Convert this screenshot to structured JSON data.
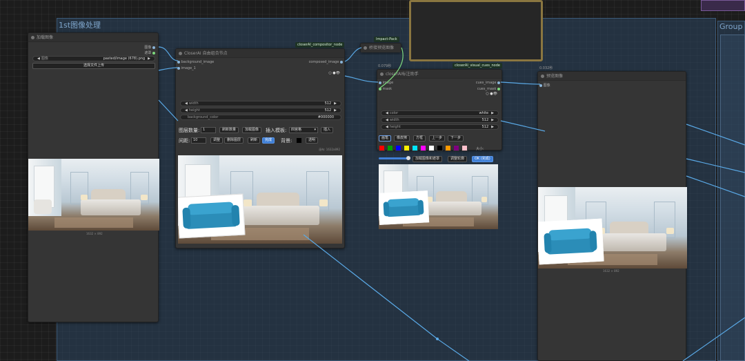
{
  "groups": [
    {
      "title": "1st图像处理"
    },
    {
      "title": "Group"
    }
  ],
  "colors": {
    "wire": "#5aa9e6",
    "canvas": "#1c1c1c",
    "node": "#353535",
    "accent": "#3f7fd6"
  },
  "load_image": {
    "title": "加载图像",
    "out_image": "图像",
    "out_mask": "遮罩",
    "image_widget_label": "图像",
    "image_widget_value": "pasted/image (678).png",
    "upload_button": "选择文件上传",
    "caption": "1632 × 892"
  },
  "compositor": {
    "badge": "closerAI_compositor_node",
    "title": "CloserAI 自由组合节点",
    "in_background": "background_image",
    "in_image1": "image_1",
    "out_composed": "composed_image",
    "width_label": "width",
    "width_value": "512",
    "height_label": "height",
    "height_value": "512",
    "bgcolor_label": "background_color",
    "bgcolor_value": "#000000",
    "layer_count_label": "图层数量:",
    "layer_count_value": "1",
    "refresh_count": "刷新数量",
    "load_image_btn": "加载图像",
    "insert_template_label": "插入模板:",
    "template_value": "四宫格",
    "insert_btn": "插入",
    "spacing_label": "间距:",
    "spacing_value": "10",
    "adjust_btn": "调整",
    "delete_layer_btn": "删除图层",
    "refresh_btn": "刷新",
    "done_btn": "完成",
    "bg_label": "背景:",
    "transparent_btn": "透明",
    "canvas_caption": "画布: 1632x892"
  },
  "bridge": {
    "badge": "Impact-Pack",
    "title": "桥接预览图像"
  },
  "visual_cues": {
    "time": "0.079秒",
    "badge": "closerAI_visual_cues_node",
    "title": "closerAI标注助手",
    "in_image": "image",
    "in_mask": "mask",
    "out_cues_image": "cues_image",
    "out_cues_mask": "cues_mask",
    "color_label": "color",
    "color_value": "white",
    "width_label": "width",
    "width_value": "512",
    "height_label": "height",
    "height_value": "512",
    "tool_brush": "画笔",
    "tool_eraser": "橡皮擦",
    "tool_rect": "方框",
    "undo": "上一步",
    "redo": "下一步",
    "size_label": "大小:",
    "load_mask_btn": "加载图像和遮罩",
    "adjust_outline_btn": "调整轮廓",
    "ok_btn": "OK (完成)",
    "swatches": [
      "#ff0000",
      "#00a000",
      "#0000ff",
      "#ffee00",
      "#00e5ff",
      "#ff00ff",
      "#ffffff",
      "#000000",
      "#ff9900",
      "#800080",
      "#ffc0cb"
    ]
  },
  "preview": {
    "time": "0.032秒",
    "title": "预览图像",
    "in_images": "图像",
    "caption": "1632 × 892"
  }
}
